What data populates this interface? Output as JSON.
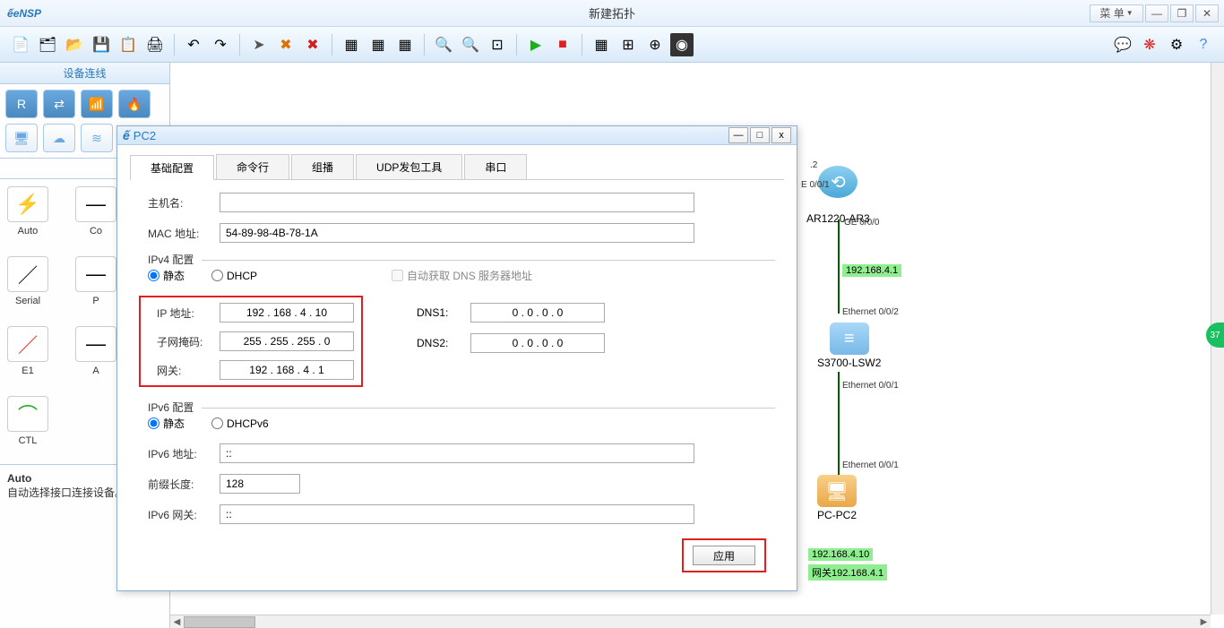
{
  "app": {
    "logo": "eNSP",
    "title": "新建拓扑",
    "menu_label": "菜 单"
  },
  "sidebar": {
    "header": "设备连线",
    "auto_label": "Auto",
    "conns": [
      {
        "label": "Auto",
        "glyph": "⚡"
      },
      {
        "label": "Co",
        "glyph": "—"
      },
      {
        "label": "Serial",
        "glyph": "／"
      },
      {
        "label": "P",
        "glyph": "—"
      },
      {
        "label": "E1",
        "glyph": "／"
      },
      {
        "label": "A",
        "glyph": "—"
      },
      {
        "label": "CTL",
        "glyph": "⌒"
      }
    ],
    "info_title": "Auto",
    "info_text": "自动选择接口连接设备。"
  },
  "dialog": {
    "title": "PC2",
    "tabs": [
      "基础配置",
      "命令行",
      "组播",
      "UDP发包工具",
      "串口"
    ],
    "hostname_label": "主机名:",
    "hostname_value": "",
    "mac_label": "MAC 地址:",
    "mac_value": "54-89-98-4B-78-1A",
    "ipv4": {
      "legend": "IPv4 配置",
      "static_label": "静态",
      "dhcp_label": "DHCP",
      "autodns_label": "自动获取 DNS 服务器地址",
      "ip_label": "IP 地址:",
      "ip_value": "192  .  168   .   4    .   10",
      "mask_label": "子网掩码:",
      "mask_value": "255  .  255  .  255  .   0",
      "gw_label": "网关:",
      "gw_value": "192  .  168   .   4    .   1",
      "dns1_label": "DNS1:",
      "dns1_value": "0    .   0    .   0    .   0",
      "dns2_label": "DNS2:",
      "dns2_value": "0    .   0    .   0    .   0"
    },
    "ipv6": {
      "legend": "IPv6 配置",
      "static_label": "静态",
      "dhcpv6_label": "DHCPv6",
      "ip_label": "IPv6 地址:",
      "ip_value": "::",
      "prefix_label": "前缀长度:",
      "prefix_value": "128",
      "gw_label": "IPv6 网关:",
      "gw_value": "::"
    },
    "apply_label": "应用"
  },
  "topology": {
    "router_iface_top": ".2",
    "router_iface_btm": "E 0/0/1",
    "router_name": "AR1220-AR3",
    "router_ge": "GE 0/0/0",
    "ip_router": "192.168.4.1",
    "switch_port_top": "Ethernet 0/0/2",
    "switch_name": "S3700-LSW2",
    "switch_port_btm": "Ethernet 0/0/1",
    "pc_port": "Ethernet 0/0/1",
    "pc_name": "PC-PC2",
    "pc_ip": "192.168.4.10",
    "pc_gw": "网关192.168.4.1"
  },
  "notif": "37"
}
